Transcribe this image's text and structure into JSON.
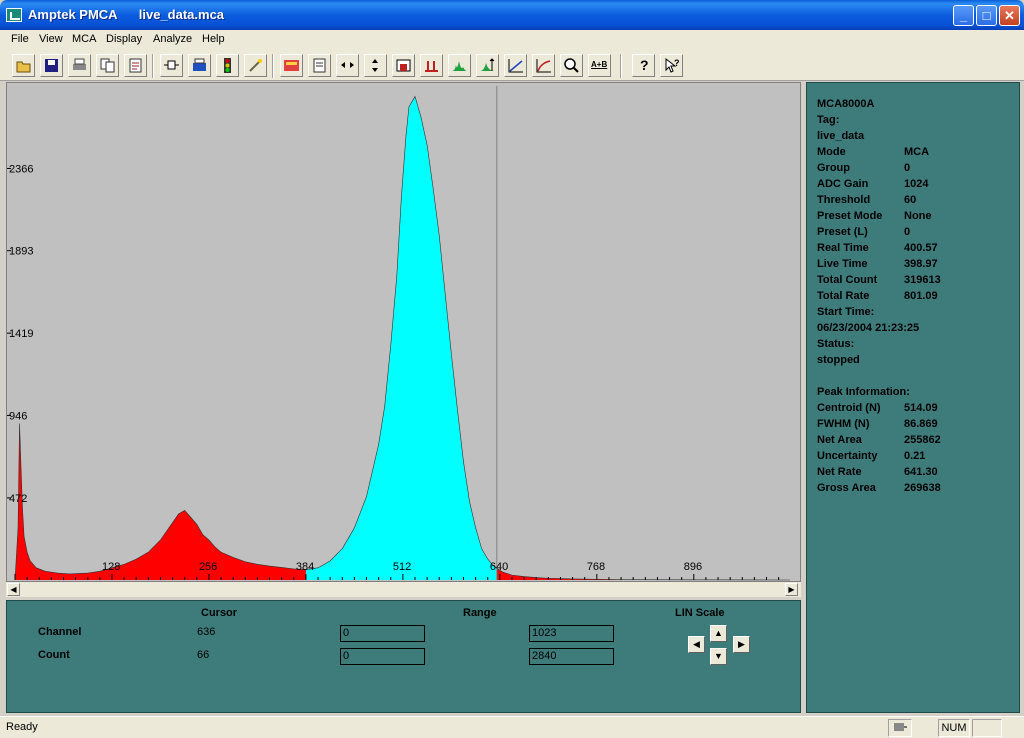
{
  "window": {
    "app_title": "Amptek PMCA",
    "file_name": "live_data.mca",
    "min_glyph": "_",
    "max_glyph": "□",
    "close_glyph": "✕"
  },
  "menu": [
    {
      "label": "File"
    },
    {
      "label": "View"
    },
    {
      "label": "MCA"
    },
    {
      "label": "Display"
    },
    {
      "label": "Analyze"
    },
    {
      "label": "Help"
    }
  ],
  "toolbar": {
    "icons": [
      "open-icon",
      "save-icon",
      "print-icon",
      "copy-icon",
      "report-icon",
      "connect-icon",
      "printer-setup-icon",
      "traffic-light-icon",
      "wand-icon",
      "color-icon",
      "properties-icon",
      "horizontal-zoom-icon",
      "vertical-zoom-icon",
      "roi-box-icon",
      "peak-markers-icon",
      "spectrum-icon",
      "autoscale-icon",
      "linear-graph-icon",
      "log-graph-icon",
      "search-icon",
      "a-plus-b-icon",
      "help-icon",
      "context-help-icon"
    ],
    "a_plus_b_label": "A+B",
    "help_label": "?"
  },
  "colors": {
    "background_region": "#ff0000",
    "roi_region": "#00ffff",
    "panel": "#3e7c7c",
    "plot_bg": "#c0c0c0"
  },
  "chart_data": {
    "type": "area",
    "xlim": [
      0,
      1023
    ],
    "ylim": [
      0,
      2840
    ],
    "y_ticks": [
      472,
      946,
      1419,
      1893,
      2366
    ],
    "y_tick_labels": [
      "472",
      "946",
      "1419",
      "1893",
      "2366"
    ],
    "x_ticks": [
      128,
      256,
      384,
      512,
      640,
      768,
      896
    ],
    "x_tick_labels": [
      "128",
      "256",
      "384",
      "512",
      "640",
      "768",
      "896"
    ],
    "roi": [
      384,
      636
    ],
    "cursor_channel": 636,
    "series": [
      {
        "x": [
          0,
          4,
          6,
          8,
          10,
          12,
          16,
          20,
          28,
          40,
          56,
          72,
          96,
          112,
          128,
          144,
          160,
          176,
          192,
          208,
          216,
          224,
          232,
          240,
          248,
          256,
          264,
          272,
          288,
          304,
          320,
          336,
          352,
          368,
          384,
          400,
          416,
          432,
          448,
          464,
          480,
          488,
          496,
          504,
          510,
          516,
          520,
          528,
          536,
          544,
          552,
          560,
          568,
          576,
          584,
          592,
          600,
          608,
          616,
          624,
          632,
          636,
          644,
          656,
          672,
          688,
          704,
          720,
          736,
          768,
          800,
          1023
        ],
        "y": [
          0,
          300,
          900,
          640,
          400,
          250,
          160,
          110,
          70,
          50,
          40,
          35,
          40,
          50,
          70,
          90,
          120,
          160,
          230,
          330,
          380,
          400,
          360,
          320,
          260,
          230,
          190,
          160,
          130,
          105,
          90,
          80,
          72,
          64,
          60,
          70,
          110,
          180,
          300,
          480,
          780,
          1000,
          1350,
          1750,
          2200,
          2550,
          2720,
          2780,
          2660,
          2500,
          2250,
          1980,
          1640,
          1300,
          980,
          680,
          450,
          300,
          180,
          120,
          80,
          66,
          45,
          28,
          20,
          14,
          10,
          8,
          6,
          4,
          2,
          0
        ]
      }
    ]
  },
  "controls": {
    "cursor_header": "Cursor",
    "range_header": "Range",
    "scale_header": "LIN Scale",
    "channel_label": "Channel",
    "count_label": "Count",
    "cursor_channel": "636",
    "cursor_count": "66",
    "range_ch_min": "0",
    "range_ch_max": "1023",
    "range_cnt_min": "0",
    "range_cnt_max": "2840",
    "up_glyph": "▲",
    "down_glyph": "▼",
    "left_glyph": "◀",
    "right_glyph": "▶"
  },
  "info": {
    "device": "MCA8000A",
    "tag_label": "Tag:",
    "tag_value": "live_data",
    "rows1": [
      {
        "label": "Mode",
        "value": "MCA"
      },
      {
        "label": "Group",
        "value": "0"
      },
      {
        "label": "ADC Gain",
        "value": "1024"
      },
      {
        "label": "Threshold",
        "value": "60"
      },
      {
        "label": "Preset Mode",
        "value": "None"
      },
      {
        "label": "Preset (L)",
        "value": "0"
      },
      {
        "label": "Real Time",
        "value": "400.57"
      },
      {
        "label": "Live Time",
        "value": "398.97"
      },
      {
        "label": "Total Count",
        "value": "319613"
      },
      {
        "label": "Total Rate",
        "value": "801.09"
      }
    ],
    "start_label": "Start Time:",
    "start_value": "06/23/2004 21:23:25",
    "status_label": "Status:",
    "status_value": "stopped",
    "peak_header": "Peak Information:",
    "rows2": [
      {
        "label": "Centroid (N)",
        "value": "514.09"
      },
      {
        "label": "FWHM (N)",
        "value": "86.869"
      },
      {
        "label": "Net Area",
        "value": "255862"
      },
      {
        "label": "Uncertainty",
        "value": "0.21"
      },
      {
        "label": "Net Rate",
        "value": "641.30"
      },
      {
        "label": "Gross Area",
        "value": "269638"
      }
    ]
  },
  "status": {
    "text": "Ready",
    "num": "NUM"
  }
}
